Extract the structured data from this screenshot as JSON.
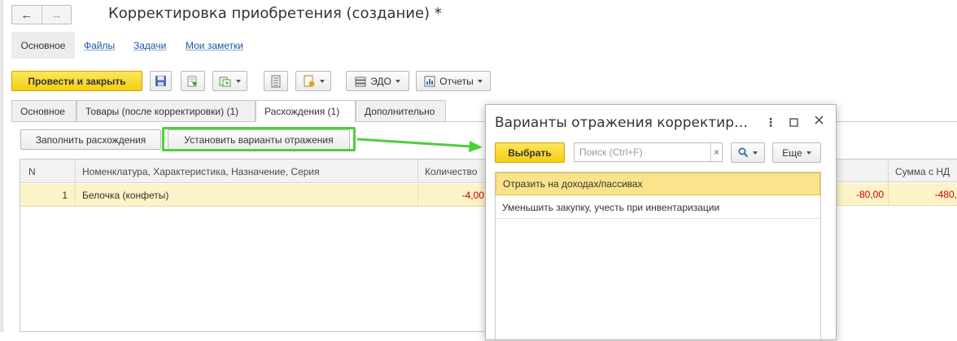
{
  "window": {
    "title": "Корректировка приобретения (создание) *",
    "nav_back": "←",
    "nav_forward": "→"
  },
  "sections": [
    "Основное",
    "Файлы",
    "Задачи",
    "Мои заметки"
  ],
  "toolbar": {
    "post_close": "Провести и закрыть",
    "edo": "ЭДО",
    "reports": "Отчеты"
  },
  "doc_tabs": [
    "Основное",
    "Товары (после корректировки) (1)",
    "Расхождения (1)",
    "Дополнительно"
  ],
  "sub_toolbar": {
    "fill": "Заполнить расхождения",
    "set_variants": "Установить варианты отражения"
  },
  "grid": {
    "headers": {
      "n": "N",
      "nomenclature": "Номенклатура, Характеристика, Назначение, Серия",
      "quantity": "Количество",
      "sum_nds": "Сумма с НД"
    },
    "rows": [
      {
        "n": "1",
        "nomenclature": "Белочка (конфеты)",
        "quantity": "-4,00",
        "sum_partial": "-80,00",
        "sum_nds": "-480,"
      }
    ]
  },
  "popup": {
    "title": "Варианты отражения корректир…",
    "select": "Выбрать",
    "search_placeholder": "Поиск (Ctrl+F)",
    "clear": "×",
    "more": "Еще",
    "items": [
      "Отразить на доходах/пассивах",
      "Уменьшить закупку, учесть при инвентаризации"
    ]
  },
  "colors": {
    "accent_yellow": "#f5cf12",
    "highlight_green": "#4fcf3a",
    "negative_red": "#cc0000",
    "row_selected": "#fdf3c8"
  }
}
